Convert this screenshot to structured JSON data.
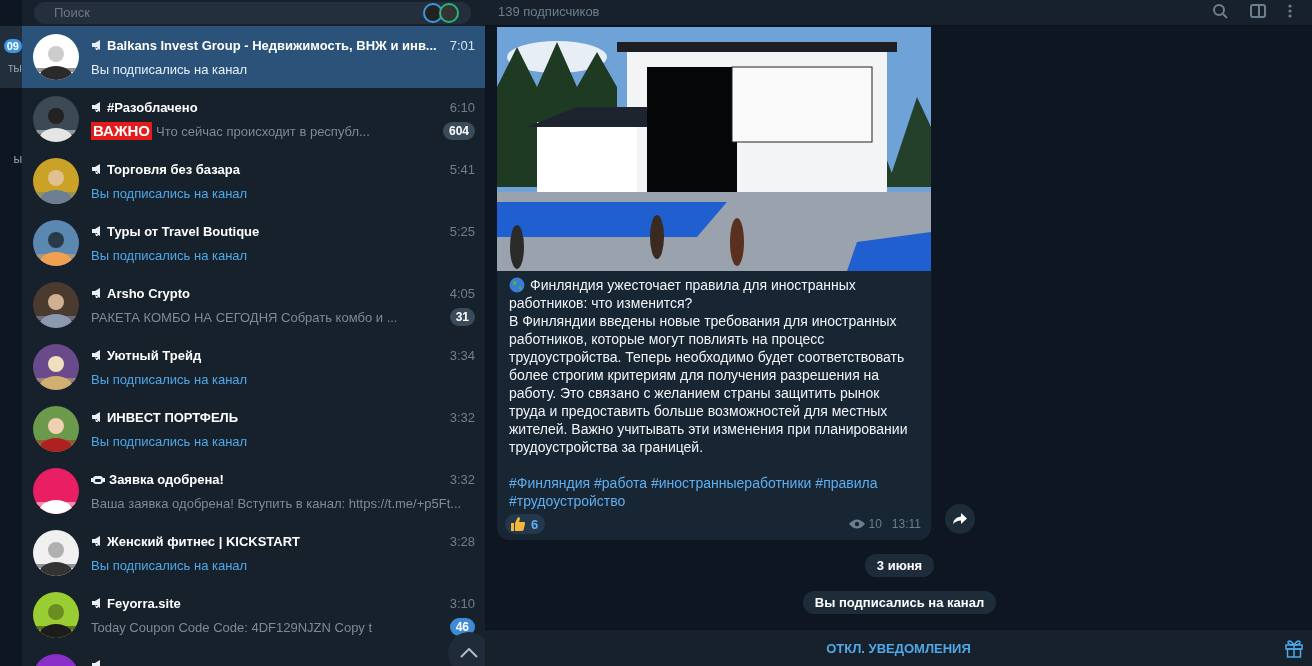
{
  "folders": [
    {
      "badge": "09",
      "label": "ты",
      "selected": true
    },
    {
      "label": "ы",
      "selected": false
    }
  ],
  "search": {
    "placeholder": "Поиск"
  },
  "chats": [
    {
      "name": "Balkans Invest Group - Недвижимость, ВНЖ и инв...",
      "kind": "channel",
      "time": "7:01",
      "preview": "Вы подписались на канал",
      "service": true,
      "selected": true
    },
    {
      "name": "#Разоблачено",
      "kind": "channel",
      "time": "6:10",
      "tag": "ВАЖНО",
      "preview": "Что сейчас происходит в республ...",
      "service": false,
      "badge": "604",
      "muted": true,
      "selected": false
    },
    {
      "name": "Торговля без базара",
      "kind": "channel",
      "time": "5:41",
      "preview": "Вы подписались на канал",
      "service": true,
      "selected": false
    },
    {
      "name": "Туры от Travel Boutique",
      "kind": "channel",
      "time": "5:25",
      "preview": "Вы подписались на канал",
      "service": true,
      "selected": false
    },
    {
      "name": "Arsho Crypto",
      "kind": "channel",
      "time": "4:05",
      "preview": "РАКЕТА КОМБО НА СЕГОДНЯ   Собрать комбо и ...",
      "service": false,
      "badge": "31",
      "muted": true,
      "selected": false
    },
    {
      "name": "Уютный Трейд",
      "kind": "channel",
      "time": "3:34",
      "preview": "Вы подписались на канал",
      "service": true,
      "selected": false
    },
    {
      "name": "ИНВЕСТ ПОРТФЕЛЬ",
      "kind": "channel",
      "time": "3:32",
      "preview": "Вы подписались на канал",
      "service": true,
      "selected": false
    },
    {
      "name": "Заявка одобрена!",
      "kind": "bot",
      "time": "3:32",
      "preview": "Ваша заявка одобрена!  Вступить в канал: https://t.me/+p5Ft...",
      "service": false,
      "selected": false
    },
    {
      "name": "Женский фитнес | KICKSTART",
      "kind": "channel",
      "time": "3:28",
      "preview": "Вы подписались на канал",
      "service": true,
      "selected": false
    },
    {
      "name": "Feyorra.site",
      "kind": "channel",
      "time": "3:10",
      "preview": "Today Coupon Code   Code: 4DF129NJZN  Copy t",
      "service": false,
      "badge": "46",
      "muted": false,
      "selected": false
    },
    {
      "kind": "channel",
      "selected": false
    }
  ],
  "header": {
    "subtitle": "139 подписчиков"
  },
  "message": {
    "paragraphs": [
      "Финляндия ужесточает правила для иностранных работников: что изменится?",
      "В Финляндии введены новые требования для иностранных работников, которые могут повлиять на процесс трудоустройства. Теперь необходимо будет соответствовать более строгим критериям для получения разрешения на работу. Это связано с желанием страны защитить рынок труда и предоставить больше возможностей для местных жителей. Важно учитывать эти изменения при планировании трудоустройства за границей."
    ],
    "hashtags": [
      "#Финляндия",
      "#работа",
      "#иностранныеработники",
      "#правила",
      "#трудоустройство"
    ],
    "reaction_count": "6",
    "views": "10",
    "time": "13:11"
  },
  "date_pill": "3 июня",
  "service_message": "Вы подписались на канал",
  "bottom_button": "ОТКЛ. УВЕДОМЛЕНИЯ"
}
